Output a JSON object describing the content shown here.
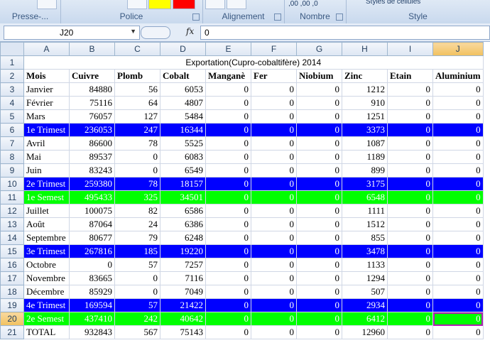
{
  "ribbon": {
    "groups": [
      {
        "label": "Presse-...",
        "key": "clipboard"
      },
      {
        "label": "Police",
        "key": "font"
      },
      {
        "label": "Alignement",
        "key": "alignment"
      },
      {
        "label": "Nombre",
        "key": "number"
      },
      {
        "label": "Style",
        "key": "style"
      }
    ],
    "styles_button": "Styles de cellules",
    "number_format_text": ",00 ,00 ,0"
  },
  "formula_bar": {
    "name_box": "J20",
    "fx_label": "fx",
    "formula": "0"
  },
  "columns": [
    "A",
    "B",
    "C",
    "D",
    "E",
    "F",
    "G",
    "H",
    "I",
    "J"
  ],
  "title": "Exportation(Cupro-cobaltifère) 2014",
  "headers": [
    "Mois",
    "Cuivre",
    "Plomb",
    "Cobalt",
    "Manganè",
    "Fer",
    "Niobium",
    "Zinc",
    "Etain",
    "Aluminium"
  ],
  "rows": [
    {
      "n": "3",
      "style": "",
      "cells": [
        "Janvier",
        "84880",
        "56",
        "6053",
        "0",
        "0",
        "0",
        "1212",
        "0",
        "0"
      ]
    },
    {
      "n": "4",
      "style": "",
      "cells": [
        "Février",
        "75116",
        "64",
        "4807",
        "0",
        "0",
        "0",
        "910",
        "0",
        "0"
      ]
    },
    {
      "n": "5",
      "style": "",
      "cells": [
        "Mars",
        "76057",
        "127",
        "5484",
        "0",
        "0",
        "0",
        "1251",
        "0",
        "0"
      ]
    },
    {
      "n": "6",
      "style": "blue",
      "cells": [
        "1e Trimest",
        "236053",
        "247",
        "16344",
        "0",
        "0",
        "0",
        "3373",
        "0",
        "0"
      ]
    },
    {
      "n": "7",
      "style": "",
      "cells": [
        "Avril",
        "86600",
        "78",
        "5525",
        "0",
        "0",
        "0",
        "1087",
        "0",
        "0"
      ]
    },
    {
      "n": "8",
      "style": "",
      "cells": [
        "Mai",
        "89537",
        "0",
        "6083",
        "0",
        "0",
        "0",
        "1189",
        "0",
        "0"
      ]
    },
    {
      "n": "9",
      "style": "",
      "cells": [
        "Juin",
        "83243",
        "0",
        "6549",
        "0",
        "0",
        "0",
        "899",
        "0",
        "0"
      ]
    },
    {
      "n": "10",
      "style": "blue",
      "cells": [
        "2e Trimest",
        "259380",
        "78",
        "18157",
        "0",
        "0",
        "0",
        "3175",
        "0",
        "0"
      ]
    },
    {
      "n": "11",
      "style": "green",
      "cells": [
        "1e Semest",
        "495433",
        "325",
        "34501",
        "0",
        "0",
        "0",
        "6548",
        "0",
        "0"
      ]
    },
    {
      "n": "12",
      "style": "",
      "cells": [
        "Juillet",
        "100075",
        "82",
        "6586",
        "0",
        "0",
        "0",
        "1111",
        "0",
        "0"
      ]
    },
    {
      "n": "13",
      "style": "",
      "cells": [
        "Août",
        "87064",
        "24",
        "6386",
        "0",
        "0",
        "0",
        "1512",
        "0",
        "0"
      ]
    },
    {
      "n": "14",
      "style": "",
      "cells": [
        "Septembre",
        "80677",
        "79",
        "6248",
        "0",
        "0",
        "0",
        "855",
        "0",
        "0"
      ]
    },
    {
      "n": "15",
      "style": "blue",
      "cells": [
        "3e Trimest",
        "267816",
        "185",
        "19220",
        "0",
        "0",
        "0",
        "3478",
        "0",
        "0"
      ]
    },
    {
      "n": "16",
      "style": "",
      "cells": [
        "Octobre",
        "0",
        "57",
        "7257",
        "0",
        "0",
        "0",
        "1133",
        "0",
        "0"
      ]
    },
    {
      "n": "17",
      "style": "",
      "cells": [
        "Novembre",
        "83665",
        "0",
        "7116",
        "0",
        "0",
        "0",
        "1294",
        "0",
        "0"
      ]
    },
    {
      "n": "18",
      "style": "",
      "cells": [
        "Décembre",
        "85929",
        "0",
        "7049",
        "0",
        "0",
        "0",
        "507",
        "0",
        "0"
      ]
    },
    {
      "n": "19",
      "style": "blue",
      "cells": [
        "4e Trimest",
        "169594",
        "57",
        "21422",
        "0",
        "0",
        "0",
        "2934",
        "0",
        "0"
      ]
    },
    {
      "n": "20",
      "style": "green",
      "cells": [
        "2e Semest",
        "437410",
        "242",
        "40642",
        "0",
        "0",
        "0",
        "6412",
        "0",
        "0"
      ]
    },
    {
      "n": "21",
      "style": "",
      "cells": [
        "TOTAL",
        "932843",
        "567",
        "75143",
        "0",
        "0",
        "0",
        "12960",
        "0",
        "0"
      ]
    }
  ],
  "active_cell": {
    "row": "20",
    "col": "J"
  },
  "colors": {
    "blue_row": "#0000ff",
    "green_row": "#00ff00",
    "selection": "#b01fb0"
  }
}
